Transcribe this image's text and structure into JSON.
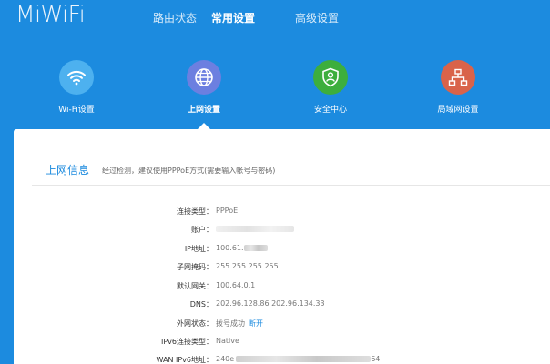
{
  "app": {
    "logo": "MiWiFi"
  },
  "nav": {
    "tabs": [
      {
        "label": "路由状态",
        "active": false
      },
      {
        "label": "常用设置",
        "active": true
      },
      {
        "label": "高级设置",
        "active": false
      }
    ]
  },
  "icons": [
    {
      "label": "Wi-Fi设置",
      "icon": "wifi-icon",
      "color": "#4db1ef",
      "active": false
    },
    {
      "label": "上网设置",
      "icon": "globe-icon",
      "color": "#6c7fe0",
      "active": true
    },
    {
      "label": "安全中心",
      "icon": "shield-icon",
      "color": "#3dae3d",
      "active": false
    },
    {
      "label": "局域网设置",
      "icon": "lan-icon",
      "color": "#d9634a",
      "active": false
    }
  ],
  "panel": {
    "title": "上网信息",
    "hint": "经过检测，建议使用PPPoE方式(需要输入帐号与密码)",
    "rows": [
      {
        "label": "连接类型：",
        "value": "PPPoE"
      },
      {
        "label": "账户：",
        "value": ""
      },
      {
        "label": "IP地址：",
        "value": "100.61."
      },
      {
        "label": "子网掩码：",
        "value": "255.255.255.255"
      },
      {
        "label": "默认网关：",
        "value": "100.64.0.1"
      },
      {
        "label": "DNS：",
        "value": "202.96.128.86 202.96.134.33"
      },
      {
        "label": "外网状态：",
        "value": "拨号成功",
        "link": "断开"
      },
      {
        "label": "IPv6连接类型：",
        "value": "Native"
      },
      {
        "label": "WAN IPv6地址：",
        "value": "240e",
        "suffix": "64"
      }
    ]
  },
  "colors": {
    "header_bg": "#1c8bdf",
    "link": "#1c8bdf"
  }
}
